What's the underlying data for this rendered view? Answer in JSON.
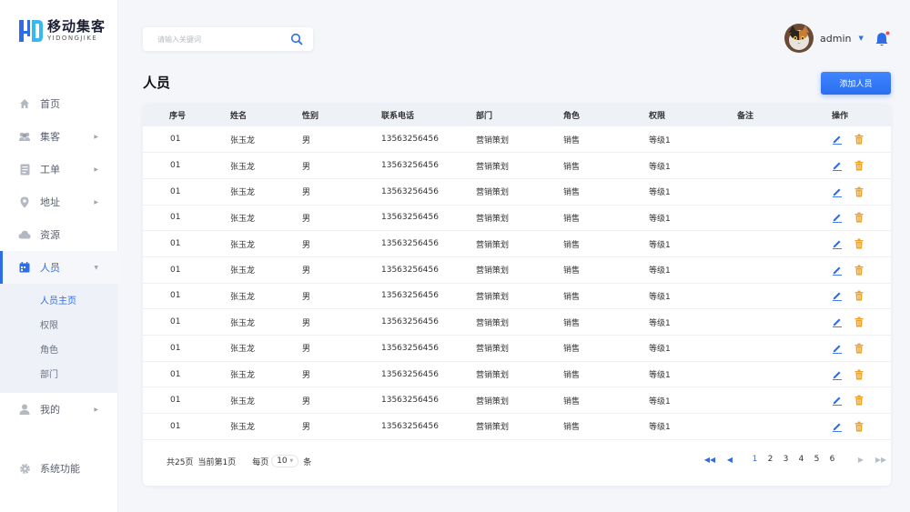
{
  "brand": {
    "logo_mark": "YD",
    "name_cn": "移动集客",
    "name_en": "YIDONGJIKE",
    "accent": "#2f6de6"
  },
  "sidebar": {
    "items": [
      {
        "label": "首页",
        "icon": "home-icon"
      },
      {
        "label": "集客",
        "icon": "group-icon"
      },
      {
        "label": "工单",
        "icon": "document-icon"
      },
      {
        "label": "地址",
        "icon": "location-pin-icon"
      },
      {
        "label": "资源",
        "icon": "cloud-icon"
      },
      {
        "label": "人员",
        "icon": "calendar-icon"
      },
      {
        "label": "我的",
        "icon": "user-icon"
      }
    ],
    "subitems": [
      "人员主页",
      "权限",
      "角色",
      "部门"
    ],
    "system": {
      "label": "系统功能",
      "icon": "gear-icon"
    }
  },
  "search": {
    "placeholder": "请输入关键词"
  },
  "header": {
    "username": "admin"
  },
  "page": {
    "title": "人员",
    "add_button": "添加人员"
  },
  "table": {
    "columns": [
      "序号",
      "姓名",
      "性别",
      "联系电话",
      "部门",
      "角色",
      "权限",
      "备注",
      "操作"
    ],
    "rows": [
      [
        "01",
        "张玉龙",
        "男",
        "13563256456",
        "营销策划",
        "销售",
        "等级1",
        ""
      ],
      [
        "01",
        "张玉龙",
        "男",
        "13563256456",
        "营销策划",
        "销售",
        "等级1",
        ""
      ],
      [
        "01",
        "张玉龙",
        "男",
        "13563256456",
        "营销策划",
        "销售",
        "等级1",
        ""
      ],
      [
        "01",
        "张玉龙",
        "男",
        "13563256456",
        "营销策划",
        "销售",
        "等级1",
        ""
      ],
      [
        "01",
        "张玉龙",
        "男",
        "13563256456",
        "营销策划",
        "销售",
        "等级1",
        ""
      ],
      [
        "01",
        "张玉龙",
        "男",
        "13563256456",
        "营销策划",
        "销售",
        "等级1",
        ""
      ],
      [
        "01",
        "张玉龙",
        "男",
        "13563256456",
        "营销策划",
        "销售",
        "等级1",
        ""
      ],
      [
        "01",
        "张玉龙",
        "男",
        "13563256456",
        "营销策划",
        "销售",
        "等级1",
        ""
      ],
      [
        "01",
        "张玉龙",
        "男",
        "13563256456",
        "营销策划",
        "销售",
        "等级1",
        ""
      ],
      [
        "01",
        "张玉龙",
        "男",
        "13563256456",
        "营销策划",
        "销售",
        "等级1",
        ""
      ],
      [
        "01",
        "张玉龙",
        "男",
        "13563256456",
        "营销策划",
        "销售",
        "等级1",
        ""
      ],
      [
        "01",
        "张玉龙",
        "男",
        "13563256456",
        "营销策划",
        "销售",
        "等级1",
        ""
      ]
    ]
  },
  "footer": {
    "total": "共25页",
    "current": "当前第1页",
    "per_page_label": "每页",
    "per_page_value": "10",
    "per_page_unit": "条"
  },
  "pagination": {
    "pages": [
      "1",
      "2",
      "3",
      "4",
      "5",
      "6"
    ],
    "current": "1"
  }
}
